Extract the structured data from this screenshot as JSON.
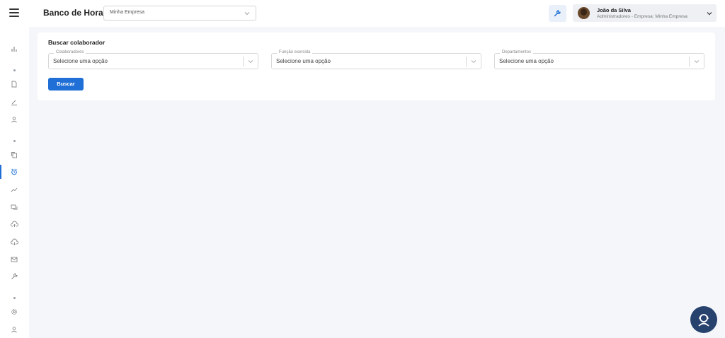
{
  "header": {
    "app_title": "Banco de Horas",
    "company_select_value": "Minha Empresa",
    "user_name": "João da Silva",
    "user_role": "Administradores - Empresa: Minha Empresa"
  },
  "sidebar": {
    "icons": [
      "chart-icon",
      "document-icon",
      "pen-icon",
      "user-icon",
      "copy-icon",
      "alarm-clock-icon",
      "trend-line-icon",
      "chat-icon",
      "cloud-upload-icon",
      "cloud-download-icon",
      "mail-icon",
      "wrench-icon",
      "gear-icon",
      "person-icon"
    ],
    "active_item": "alarm-clock-icon"
  },
  "search_card": {
    "title": "Buscar colaborador",
    "fields": [
      {
        "label": "Colaboradores",
        "value": "Selecione uma opção"
      },
      {
        "label": "Função exercida",
        "value": "Selecione uma opção"
      },
      {
        "label": "Departamentos",
        "value": "Selecione uma opção"
      }
    ],
    "button_label": "Buscar"
  },
  "colors": {
    "accent": "#1f6fd6",
    "fab": "#28426e",
    "background": "#f5f6fa"
  }
}
